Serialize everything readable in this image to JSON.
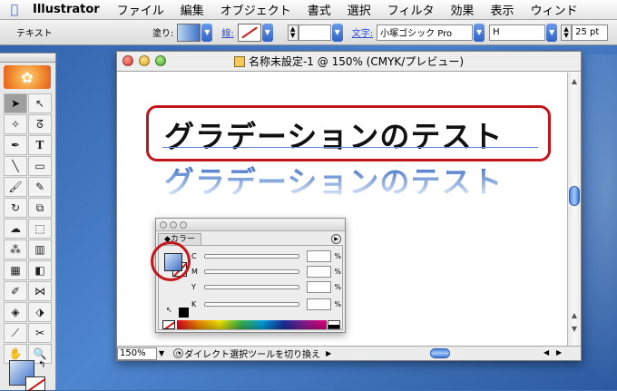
{
  "menubar": {
    "app_name": "Illustrator",
    "items": [
      "ファイル",
      "編集",
      "オブジェクト",
      "書式",
      "選択",
      "フィルタ",
      "効果",
      "表示",
      "ウィンド"
    ]
  },
  "control_bar": {
    "mode_label": "テキスト",
    "fill_label": "塗り:",
    "stroke_label": "線:",
    "character_label": "文字:",
    "font_name": "小塚ゴシック Pro",
    "font_style": "H",
    "font_size": "25 pt"
  },
  "document": {
    "title": "名称未設定-1 @ 150% (CMYK/プレビュー)",
    "zoom": "150%",
    "status": "ダイレクト選択ツールを切り換え",
    "headline": "グラデーションのテスト",
    "headline_gradient": "グラデーションのテスト"
  },
  "color_panel": {
    "tab_label": "◆カラー",
    "channels": [
      {
        "label": "C",
        "unit": "%"
      },
      {
        "label": "M",
        "unit": "%"
      },
      {
        "label": "Y",
        "unit": "%"
      },
      {
        "label": "K",
        "unit": "%"
      }
    ]
  },
  "colors": {
    "highlight_red": "#c2161b",
    "gradient_blue": "#3f6ec5"
  }
}
